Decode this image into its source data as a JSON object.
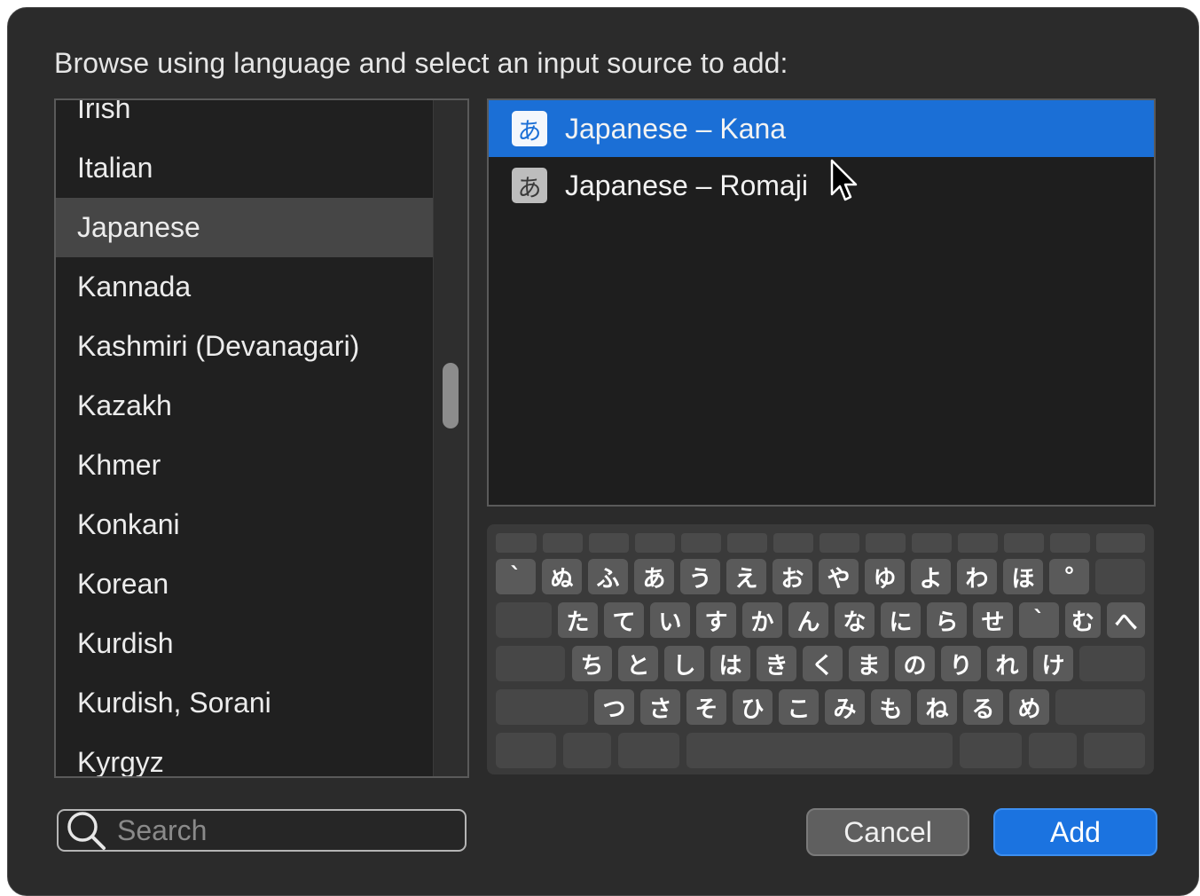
{
  "dialog": {
    "prompt": "Browse using language and select an input source to add:"
  },
  "languages": {
    "items": [
      {
        "label": "Irish",
        "selected": false
      },
      {
        "label": "Italian",
        "selected": false
      },
      {
        "label": "Japanese",
        "selected": true
      },
      {
        "label": "Kannada",
        "selected": false
      },
      {
        "label": "Kashmiri (Devanagari)",
        "selected": false
      },
      {
        "label": "Kazakh",
        "selected": false
      },
      {
        "label": "Khmer",
        "selected": false
      },
      {
        "label": "Konkani",
        "selected": false
      },
      {
        "label": "Korean",
        "selected": false
      },
      {
        "label": "Kurdish",
        "selected": false
      },
      {
        "label": "Kurdish, Sorani",
        "selected": false
      },
      {
        "label": "Kyrgyz",
        "selected": false
      }
    ]
  },
  "sources": {
    "items": [
      {
        "icon_char": "あ",
        "icon": "hiragana-a-icon",
        "label": "Japanese – Kana",
        "selected": true
      },
      {
        "icon_char": "あ",
        "icon": "hiragana-a-icon",
        "label": "Japanese – Romaji",
        "selected": false
      }
    ]
  },
  "keyboard": {
    "row1": [
      "`",
      "ぬ",
      "ふ",
      "あ",
      "う",
      "え",
      "お",
      "や",
      "ゆ",
      "よ",
      "わ",
      "ほ",
      "°"
    ],
    "row2": [
      "た",
      "て",
      "い",
      "す",
      "か",
      "ん",
      "な",
      "に",
      "ら",
      "せ",
      "`",
      "む",
      "へ"
    ],
    "row3": [
      "ち",
      "と",
      "し",
      "は",
      "き",
      "く",
      "ま",
      "の",
      "り",
      "れ",
      "け"
    ],
    "row4": [
      "つ",
      "さ",
      "そ",
      "ひ",
      "こ",
      "み",
      "も",
      "ね",
      "る",
      "め"
    ]
  },
  "search": {
    "placeholder": "Search",
    "value": ""
  },
  "buttons": {
    "cancel": "Cancel",
    "add": "Add"
  },
  "colors": {
    "accent": "#1b6fd6",
    "dialog_bg": "#2b2b2b"
  }
}
